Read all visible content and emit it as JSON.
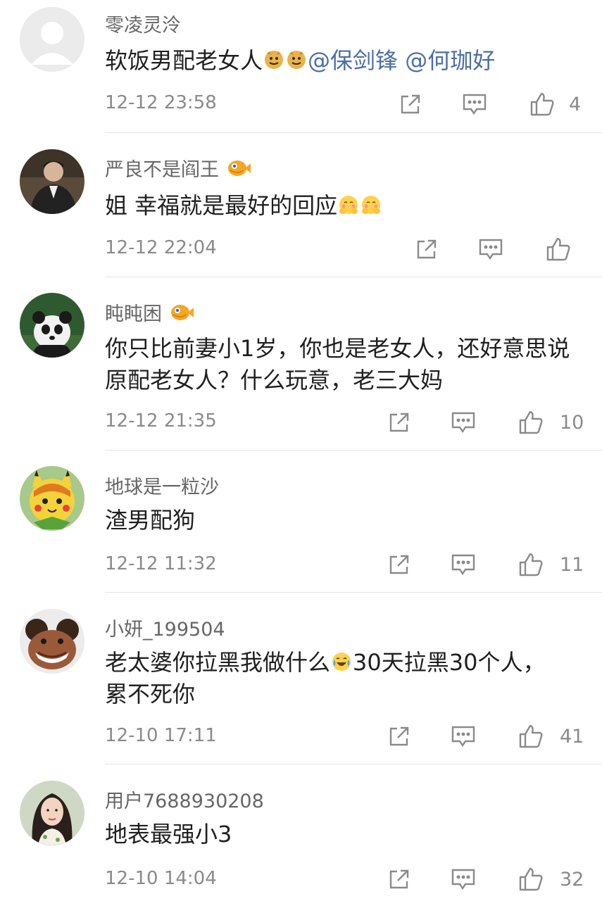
{
  "comments": [
    {
      "username": "零凌灵泠",
      "text": "软饭男配老女人",
      "emojis": [
        "doge-emoji",
        "doge-emoji"
      ],
      "mentions": [
        "@保剑锋",
        "@何珈好"
      ],
      "time": "12-12 23:58",
      "likes": "4",
      "avatar": "default-avatar",
      "badge": null
    },
    {
      "username": "严良不是阎王",
      "text": "姐 幸福就是最好的回应",
      "emojis": [
        "hug-emoji",
        "hug-emoji"
      ],
      "time": "12-12 22:04",
      "likes": "",
      "avatar": "man-suit-photo",
      "badge": "fish-badge"
    },
    {
      "username": "盹盹困",
      "text": "你只比前妻小1岁，你也是老女人，还好意思说原配老女人？什么玩意，老三大妈",
      "time": "12-12 21:35",
      "likes": "10",
      "avatar": "panda-photo",
      "badge": "fish-badge"
    },
    {
      "username": "地球是一粒沙",
      "text": "渣男配狗",
      "time": "12-12 11:32",
      "likes": "11",
      "avatar": "pikachu-avatar",
      "badge": null
    },
    {
      "username": "小妍_199504",
      "text_before": "老太婆你拉黑我做什么",
      "emoji": "laugh-cry-emoji",
      "text_after": "30天拉黑30个人，累不死你",
      "time": "12-10 17:11",
      "likes": "41",
      "avatar": "hippo-avatar",
      "badge": null
    },
    {
      "username": "用户7688930208",
      "text": "地表最强小3",
      "time": "12-10 14:04",
      "likes": "32",
      "avatar": "woman-photo",
      "badge": null
    }
  ],
  "actions": [
    "share-icon",
    "reply-icon",
    "like-icon"
  ]
}
